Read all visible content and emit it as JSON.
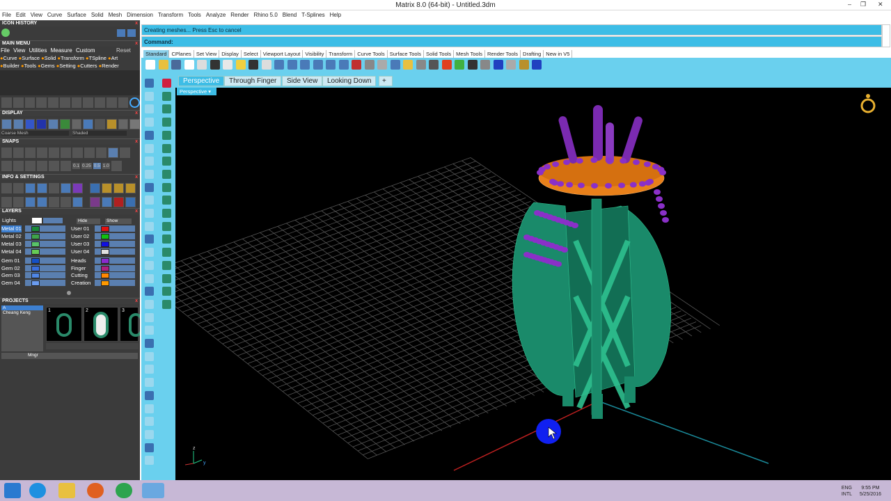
{
  "window": {
    "title": "Matrix 8.0 (64-bit) - Untitled.3dm"
  },
  "menu": [
    "File",
    "Edit",
    "View",
    "Curve",
    "Surface",
    "Solid",
    "Mesh",
    "Dimension",
    "Transform",
    "Tools",
    "Analyze",
    "Render",
    "Rhino 5.0",
    "Blend",
    "T-Splines",
    "Help"
  ],
  "left": {
    "icon_history": "ICON HISTORY",
    "main_menu": "MAIN MENU",
    "main_menu_row1": [
      "File",
      "View",
      "Utilities",
      "Measure",
      "Custom"
    ],
    "reset": "Reset",
    "main_menu_row2": [
      "Curve",
      "Surface",
      "Solid",
      "Transform",
      "TSpline",
      "Art"
    ],
    "main_menu_row3": [
      "Builder",
      "Tools",
      "Gems",
      "Setting",
      "Cutters",
      "Render"
    ],
    "display": "DISPLAY",
    "display_modes": [
      "Coarse Mesh",
      "Shaded"
    ],
    "snaps": "SNAPS",
    "snap_values": [
      "0.1",
      "0.25",
      "0.5",
      "1.0"
    ],
    "info": "INFO & SETTINGS",
    "layers": "LAYERS",
    "lights": "Lights",
    "hide": "Hide",
    "show": "Show",
    "layers_left": [
      {
        "name": "Metal 01",
        "color": "#1a8a3a"
      },
      {
        "name": "Metal 02",
        "color": "#3fa34a"
      },
      {
        "name": "Metal 03",
        "color": "#58c368"
      },
      {
        "name": "Metal 04",
        "color": "#66cc55"
      },
      {
        "name": "Gem 01",
        "color": "#1450c8"
      },
      {
        "name": "Gem 02",
        "color": "#3a6fe0"
      },
      {
        "name": "Gem 03",
        "color": "#4f86e6"
      },
      {
        "name": "Gem 04",
        "color": "#6a9cf0"
      }
    ],
    "layers_right": [
      {
        "name": "User 01",
        "color": "#e01010"
      },
      {
        "name": "User 02",
        "color": "#10c010"
      },
      {
        "name": "User 03",
        "color": "#1010e0"
      },
      {
        "name": "User 04",
        "color": "#e0e0e0"
      },
      {
        "name": "Heads",
        "color": "#8a2bd0"
      },
      {
        "name": "Finger",
        "color": "#b02080"
      },
      {
        "name": "Cutting",
        "color": "#ff8800"
      },
      {
        "name": "Creation",
        "color": "#ff9900"
      }
    ],
    "projects": "PROJECTS",
    "project_user": "Cheang Keng",
    "project_letter": "A",
    "project_thumbs": [
      "1",
      "2",
      "3"
    ],
    "mngr": "Mngr"
  },
  "command": {
    "status": "Creating meshes... Press Esc to cancel",
    "label": "Command:"
  },
  "toolbar_tabs": [
    "Standard",
    "CPlanes",
    "Set View",
    "Display",
    "Select",
    "Viewport Layout",
    "Visibility",
    "Transform",
    "Curve Tools",
    "Surface Tools",
    "Solid Tools",
    "Mesh Tools",
    "Render Tools",
    "Drafting",
    "New in V5"
  ],
  "viewport_tabs": [
    "Perspective",
    "Through Finger",
    "Side View",
    "Looking Down"
  ],
  "viewport": {
    "name": "Perspective",
    "axis_z": "z",
    "axis_y": "y"
  },
  "taskbar": {
    "lang": [
      "ENG",
      "INTL"
    ],
    "time": "9:55 PM",
    "date": "5/25/2016"
  }
}
